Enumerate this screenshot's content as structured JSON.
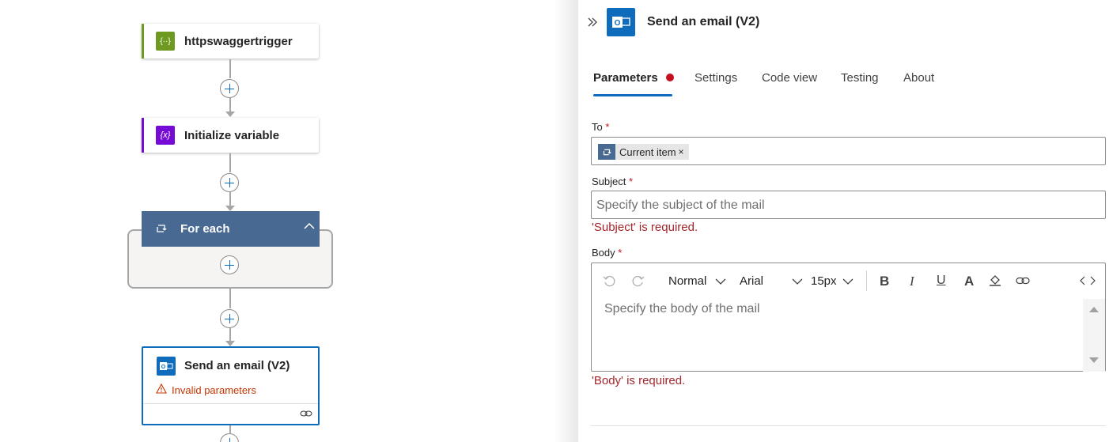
{
  "canvas": {
    "nodes": {
      "trigger": {
        "title": "httpswaggertrigger",
        "icon": "swagger-trigger-icon",
        "accent": "#6f9a22"
      },
      "init_var": {
        "title": "Initialize variable",
        "icon": "variable-icon",
        "icon_text": "{x}",
        "accent": "#770bd6"
      },
      "foreach": {
        "title": "For each",
        "icon": "loop-icon",
        "accent": "#486991"
      },
      "send_email": {
        "title": "Send an email (V2)",
        "icon": "outlook-icon",
        "warning": "Invalid parameters",
        "accent": "#0f6cbd"
      }
    }
  },
  "panel": {
    "header": {
      "title": "Send an email (V2)",
      "icon": "outlook-icon",
      "collapse_icon": "double-chevron-right-icon"
    },
    "tabs": [
      {
        "label": "Parameters",
        "active": true,
        "error": true
      },
      {
        "label": "Settings"
      },
      {
        "label": "Code view"
      },
      {
        "label": "Testing"
      },
      {
        "label": "About"
      }
    ],
    "fields": {
      "to": {
        "label": "To",
        "required": "*",
        "token": "Current item",
        "token_remove": "×"
      },
      "subject": {
        "label": "Subject",
        "required": "*",
        "placeholder": "Specify the subject of the mail",
        "error": "'Subject' is required."
      },
      "body": {
        "label": "Body",
        "required": "*",
        "placeholder": "Specify the body of the mail",
        "error": "'Body' is required."
      }
    },
    "editor_toolbar": {
      "block_type": "Normal",
      "font": "Arial",
      "font_size": "15px",
      "buttons": [
        "undo-icon",
        "redo-icon",
        "bold-icon",
        "italic-icon",
        "underline-icon",
        "font-color-icon",
        "highlight-icon",
        "link-icon",
        "code-view-icon"
      ]
    },
    "colors": {
      "primary": "#0f6cbd",
      "error": "#a4262c",
      "required": "#c50f1f"
    }
  }
}
